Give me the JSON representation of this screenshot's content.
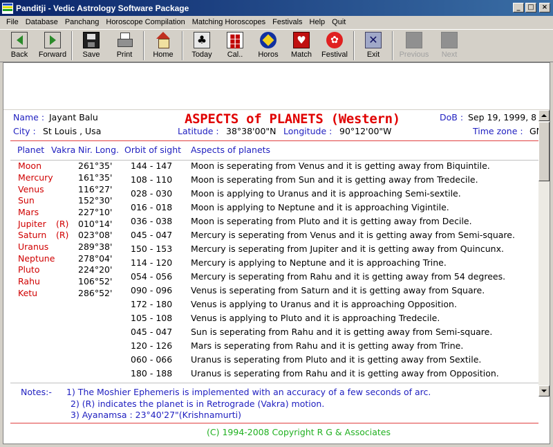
{
  "window": {
    "title": "Panditji - Vedic Astrology Software Package"
  },
  "menu": [
    "File",
    "Database",
    "Panchang",
    "Horoscope Compilation",
    "Matching Horoscopes",
    "Festivals",
    "Help",
    "Quit"
  ],
  "toolbar": {
    "back": "Back",
    "forward": "Forward",
    "save": "Save",
    "print": "Print",
    "home": "Home",
    "today": "Today",
    "calendar": "Cal..",
    "horos": "Horos",
    "match": "Match",
    "festival": "Festival",
    "exit": "Exit",
    "previous": "Previous",
    "next": "Next"
  },
  "report": {
    "title": "ASPECTS of PLANETS (Western)",
    "name_label": "Name :",
    "name": "Jayant Balu",
    "dob_label": "DoB :",
    "dob": "Sep 19, 1999, 8",
    "city_label": "City :",
    "city": "St Louis , Usa",
    "latitude_label": "Latitude :",
    "latitude": "38°38'00\"N",
    "longitude_label": "Longitude :",
    "longitude": "90°12'00\"W",
    "timezone_label": "Time zone :",
    "timezone": "GM",
    "columns": {
      "planet": "Planet",
      "vakra": "Vakra",
      "nir_long": "Nir. Long.",
      "orbit": "Orbit of sight",
      "aspects": "Aspects of planets"
    },
    "planets": [
      {
        "name": "Moon",
        "vakra": "",
        "long": "261°35'"
      },
      {
        "name": "Mercury",
        "vakra": "",
        "long": "161°35'"
      },
      {
        "name": "Venus",
        "vakra": "",
        "long": "116°27'"
      },
      {
        "name": "Sun",
        "vakra": "",
        "long": "152°30'"
      },
      {
        "name": "Mars",
        "vakra": "",
        "long": "227°10'"
      },
      {
        "name": "Jupiter",
        "vakra": "(R)",
        "long": "010°14'"
      },
      {
        "name": "Saturn",
        "vakra": "(R)",
        "long": "023°08'"
      },
      {
        "name": "Uranus",
        "vakra": "",
        "long": "289°38'"
      },
      {
        "name": "Neptune",
        "vakra": "",
        "long": "278°04'"
      },
      {
        "name": "Pluto",
        "vakra": "",
        "long": "224°20'"
      },
      {
        "name": "Rahu",
        "vakra": "",
        "long": "106°52'"
      },
      {
        "name": "Ketu",
        "vakra": "",
        "long": "286°52'"
      }
    ],
    "aspects": [
      {
        "orbit": "144 - 147",
        "text": "Moon is seperating from Venus and it is getting away from Biquintile."
      },
      {
        "orbit": "108 - 110",
        "text": "Moon is seperating from Sun and it is getting away from Tredecile."
      },
      {
        "orbit": "028 - 030",
        "text": "Moon is applying to Uranus and it is approaching Semi-sextile."
      },
      {
        "orbit": "016 - 018",
        "text": "Moon is applying to Neptune and it is approaching Vigintile."
      },
      {
        "orbit": "036 - 038",
        "text": "Moon is seperating from Pluto and it is getting away from Decile."
      },
      {
        "orbit": "045 - 047",
        "text": "Mercury is seperating from Venus and it is getting away from Semi-square."
      },
      {
        "orbit": "150 - 153",
        "text": "Mercury is seperating from Jupiter and it is getting away from Quincunx."
      },
      {
        "orbit": "114 - 120",
        "text": "Mercury is applying to Neptune and it is approaching Trine."
      },
      {
        "orbit": "054 - 056",
        "text": "Mercury is seperating from Rahu and it is getting away from 54 degrees."
      },
      {
        "orbit": "090 - 096",
        "text": "Venus is seperating from Saturn and it is getting away from Square."
      },
      {
        "orbit": "172 - 180",
        "text": "Venus is applying to Uranus and it is approaching Opposition."
      },
      {
        "orbit": "105 - 108",
        "text": "Venus is applying to Pluto and it is approaching Tredecile."
      },
      {
        "orbit": "045 - 047",
        "text": "Sun is seperating from Rahu and it is getting away from Semi-square."
      },
      {
        "orbit": "120 - 126",
        "text": "Mars is seperating from Rahu and it is getting away from Trine."
      },
      {
        "orbit": "060 - 066",
        "text": "Uranus is seperating from Pluto and it is getting away from Sextile."
      },
      {
        "orbit": "180 - 188",
        "text": "Uranus is seperating from Rahu and it is getting away from Opposition."
      }
    ],
    "notes_label": "Notes:-",
    "notes": [
      "1) The Moshier Ephemeris is implemented with an accuracy of a few seconds of arc.",
      "2) (R) indicates the planet is in Retrograde (Vakra) motion.",
      "3) Ayanamsa : 23°40'27\"(Krishnamurti)"
    ],
    "copyright": "(C) 1994-2008 Copyright R G & Associates"
  },
  "colors": {
    "label": "#2020c0",
    "planet": "#d00000",
    "heading": "#e00000",
    "copyright": "#20b020"
  }
}
